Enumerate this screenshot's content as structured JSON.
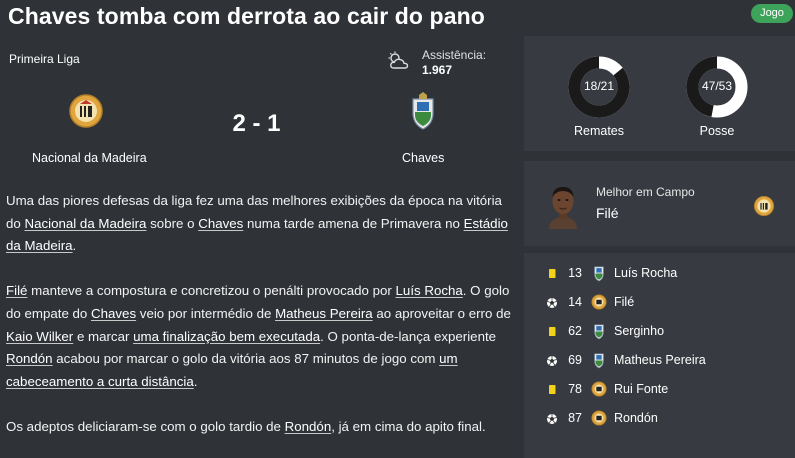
{
  "header": {
    "headline": "Chaves tomba com derrota ao cair do pano",
    "badge": "Jogo"
  },
  "match": {
    "competition": "Primeira Liga",
    "weather_icon": "cloud-sun-icon",
    "attendance_label": "Assistência:",
    "attendance_value": "1.967",
    "score": "2 - 1",
    "home_team": "Nacional da Madeira",
    "away_team": "Chaves"
  },
  "report": {
    "paragraphs": [
      [
        {
          "t": "Uma das piores defesas da liga fez uma das melhores exibições da época na vitória do "
        },
        {
          "t": "Nacional da Madeira",
          "link": true
        },
        {
          "t": " sobre o "
        },
        {
          "t": "Chaves",
          "link": true
        },
        {
          "t": " numa tarde amena de Primavera no "
        },
        {
          "t": "Estádio da Madeira",
          "link": true
        },
        {
          "t": "."
        }
      ],
      [
        {
          "t": "Filé",
          "link": true
        },
        {
          "t": " manteve a compostura e concretizou o penálti provocado por "
        },
        {
          "t": "Luís Rocha",
          "link": true
        },
        {
          "t": ". O golo do empate do "
        },
        {
          "t": "Chaves",
          "link": true
        },
        {
          "t": " veio por intermédio de "
        },
        {
          "t": "Matheus Pereira",
          "link": true
        },
        {
          "t": " ao aproveitar o erro de "
        },
        {
          "t": "Kaio Wilker",
          "link": true
        },
        {
          "t": " e marcar "
        },
        {
          "t": "uma finalização bem executada",
          "link": true
        },
        {
          "t": ". O ponta-de-lança experiente "
        },
        {
          "t": "Rondón",
          "link": true
        },
        {
          "t": " acabou por marcar o golo da vitória aos 87 minutos de jogo com "
        },
        {
          "t": "um cabeceamento a curta distância",
          "link": true
        },
        {
          "t": "."
        }
      ],
      [
        {
          "t": "Os adeptos deliciaram-se com o golo tardio de "
        },
        {
          "t": "Rondón",
          "link": true
        },
        {
          "t": ", já em cima do apito final."
        }
      ]
    ]
  },
  "stats": {
    "shots": {
      "value": "18/21",
      "label": "Remates",
      "home_fraction": 0.857
    },
    "possession": {
      "value": "47/53",
      "label": "Posse",
      "home_fraction": 0.47
    }
  },
  "motm": {
    "label": "Melhor em Campo",
    "name": "Filé",
    "team": "home"
  },
  "events": [
    {
      "type": "yellow-card",
      "minute": "13",
      "team": "away",
      "player": "Luís Rocha"
    },
    {
      "type": "goal",
      "minute": "14",
      "team": "home",
      "player": "Filé"
    },
    {
      "type": "yellow-card",
      "minute": "62",
      "team": "away",
      "player": "Serginho"
    },
    {
      "type": "goal",
      "minute": "69",
      "team": "away",
      "player": "Matheus Pereira"
    },
    {
      "type": "yellow-card",
      "minute": "78",
      "team": "home",
      "player": "Rui Fonte"
    },
    {
      "type": "goal",
      "minute": "87",
      "team": "home",
      "player": "Rondón"
    }
  ],
  "colors": {
    "background": "#2f3338",
    "panel": "#373b41",
    "badge": "#3ea35a",
    "yellow_card": "#f2d21b",
    "donut_home": "#1a1a1a",
    "donut_away": "#ffffff"
  }
}
